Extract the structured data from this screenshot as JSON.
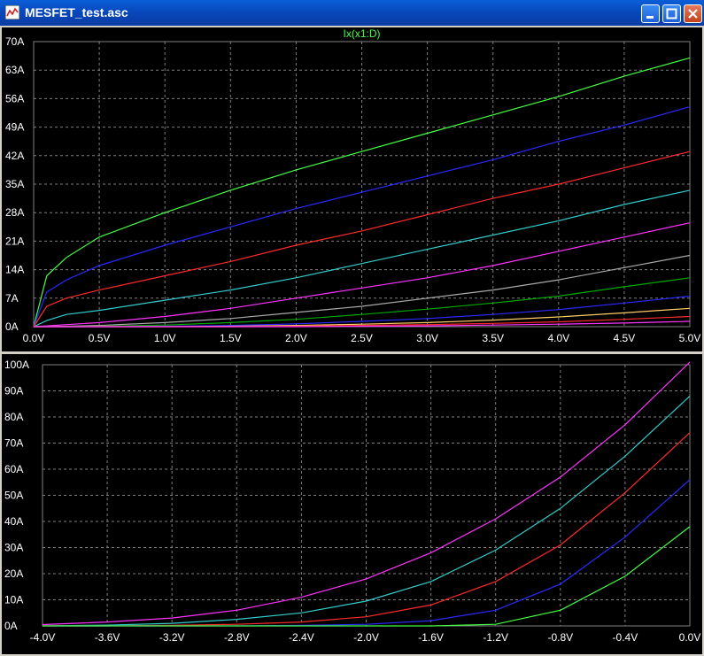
{
  "window": {
    "title": "MESFET_test.asc"
  },
  "colors": {
    "background": "#000000",
    "grid": "#808080",
    "text": "#ffffff",
    "title_text": "#44ff44"
  },
  "chart_data": [
    {
      "type": "line",
      "title": "Ix(x1:D)",
      "xlabel": "",
      "ylabel": "",
      "xlim": [
        0,
        5
      ],
      "ylim": [
        0,
        70
      ],
      "x_ticks": [
        "0.0V",
        "0.5V",
        "1.0V",
        "1.5V",
        "2.0V",
        "2.5V",
        "3.0V",
        "3.5V",
        "4.0V",
        "4.5V",
        "5.0V"
      ],
      "y_ticks": [
        "0A",
        "7A",
        "14A",
        "21A",
        "28A",
        "35A",
        "42A",
        "49A",
        "56A",
        "63A",
        "70A"
      ],
      "grid": true,
      "x": [
        0,
        0.1,
        0.25,
        0.5,
        1.0,
        1.5,
        2.0,
        2.5,
        3.0,
        3.5,
        4.0,
        4.5,
        5.0
      ],
      "series": [
        {
          "color": "#44ff44",
          "values": [
            0,
            12.5,
            17,
            22,
            28,
            33.5,
            38.5,
            43,
            47.5,
            52,
            56.5,
            61.5,
            66
          ]
        },
        {
          "color": "#2a2aff",
          "values": [
            0,
            8.5,
            11.5,
            15,
            20,
            24.5,
            29,
            33,
            37,
            41,
            45.5,
            49.5,
            54
          ]
        },
        {
          "color": "#ff2a2a",
          "values": [
            0,
            5,
            7,
            9,
            12.5,
            16,
            20,
            23.5,
            27.5,
            31.5,
            35,
            39,
            43
          ]
        },
        {
          "color": "#33cccc",
          "values": [
            0,
            1.5,
            3,
            4,
            6.5,
            9,
            12,
            15.5,
            19,
            22.5,
            26,
            30,
            33.5
          ]
        },
        {
          "color": "#ff33ff",
          "values": [
            0,
            0.2,
            0.5,
            1,
            2.5,
            4.5,
            7,
            9.5,
            12,
            15,
            18.5,
            22,
            25.5
          ]
        },
        {
          "color": "#aaaaaa",
          "values": [
            0,
            0,
            0.1,
            0.3,
            1,
            2,
            3.5,
            5,
            7,
            9,
            11.5,
            14.5,
            17.5
          ]
        },
        {
          "color": "#00aa00",
          "values": [
            0,
            0,
            0,
            0.1,
            0.4,
            1,
            1.8,
            3,
            4.3,
            5.8,
            7.5,
            9.8,
            12
          ]
        },
        {
          "color": "#2a2aff",
          "values": [
            0,
            0,
            0,
            0,
            0.1,
            0.3,
            0.7,
            1.3,
            2,
            3,
            4.2,
            5.8,
            7.5
          ]
        },
        {
          "color": "#ffcc66",
          "values": [
            0,
            0,
            0,
            0,
            0,
            0.1,
            0.3,
            0.6,
            1,
            1.6,
            2.4,
            3.4,
            4.5
          ]
        },
        {
          "color": "#ff2a2a",
          "values": [
            0,
            0,
            0,
            0,
            0,
            0,
            0.1,
            0.3,
            0.5,
            0.8,
            1.2,
            1.8,
            2.5
          ]
        },
        {
          "color": "#ff33ff",
          "values": [
            0,
            0,
            0,
            0,
            0,
            0,
            0,
            0.1,
            0.2,
            0.4,
            0.6,
            0.9,
            1.3
          ]
        }
      ]
    },
    {
      "type": "line",
      "title": "",
      "xlabel": "",
      "ylabel": "",
      "xlim": [
        -4,
        0
      ],
      "ylim": [
        0,
        100
      ],
      "x_ticks": [
        "-4.0V",
        "-3.6V",
        "-3.2V",
        "-2.8V",
        "-2.4V",
        "-2.0V",
        "-1.6V",
        "-1.2V",
        "-0.8V",
        "-0.4V",
        "0.0V"
      ],
      "y_ticks": [
        "0A",
        "10A",
        "20A",
        "30A",
        "40A",
        "50A",
        "60A",
        "70A",
        "80A",
        "90A",
        "100A"
      ],
      "grid": true,
      "x": [
        -4.0,
        -3.6,
        -3.2,
        -2.8,
        -2.4,
        -2.0,
        -1.6,
        -1.2,
        -0.8,
        -0.4,
        0.0
      ],
      "series": [
        {
          "color": "#ff33ff",
          "values": [
            0.5,
            1.5,
            3,
            6,
            11,
            18,
            28,
            41,
            57,
            77,
            101
          ]
        },
        {
          "color": "#33cccc",
          "values": [
            0,
            0.3,
            1,
            2.5,
            5,
            9.5,
            17,
            29,
            45,
            65,
            88
          ]
        },
        {
          "color": "#ff2a2a",
          "values": [
            0,
            0,
            0.2,
            0.6,
            1.5,
            3.5,
            8,
            17,
            31,
            51,
            74
          ]
        },
        {
          "color": "#2a2aff",
          "values": [
            0,
            0,
            0,
            0,
            0.2,
            0.6,
            2,
            6,
            16,
            34,
            56
          ]
        },
        {
          "color": "#44ff44",
          "values": [
            0,
            0,
            0,
            0,
            0,
            0,
            0,
            0.6,
            6,
            19,
            38
          ]
        }
      ]
    }
  ]
}
